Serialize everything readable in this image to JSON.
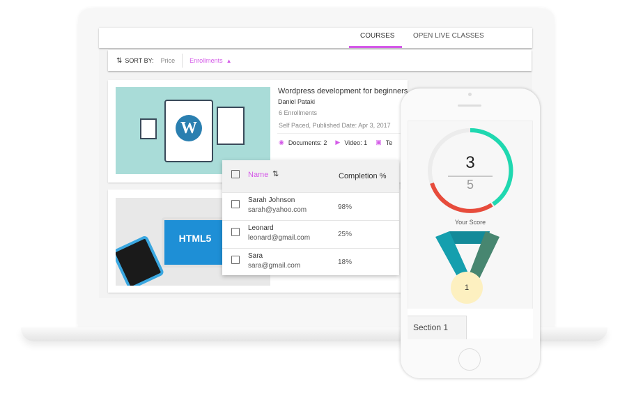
{
  "tabs": [
    {
      "label": "COURSES",
      "active": true
    },
    {
      "label": "OPEN LIVE CLASSES",
      "active": false
    }
  ],
  "sort": {
    "label": "SORT BY:",
    "options": [
      "Price",
      "Enrollments"
    ],
    "active": "Enrollments"
  },
  "course": {
    "title": "Wordpress development for beginners",
    "author": "Daniel Pataki",
    "enrollments": "6 Enrollments",
    "meta": "Self Paced, Published Date: Apr 3, 2017",
    "documents": "Documents: 2",
    "video": "Video: 1",
    "text": "Te"
  },
  "course2": {
    "image_text": "HTML5"
  },
  "table": {
    "headers": {
      "name": "Name",
      "completion": "Completion %"
    },
    "rows": [
      {
        "name": "Sarah Johnson",
        "email": "sarah@yahoo.com",
        "completion": "98%"
      },
      {
        "name": "Leonard",
        "email": "leonard@gmail.com",
        "completion": "25%"
      },
      {
        "name": "Sara",
        "email": "sara@gmail.com",
        "completion": "18%"
      }
    ]
  },
  "score": {
    "value": "3",
    "total": "5",
    "label": "Your Score",
    "medal": "1",
    "section": "Section 1"
  },
  "colors": {
    "accent": "#d45ae8",
    "ring_green": "#1fd8b0",
    "ring_red": "#e74c3c",
    "medal": "#fdf0c0"
  }
}
